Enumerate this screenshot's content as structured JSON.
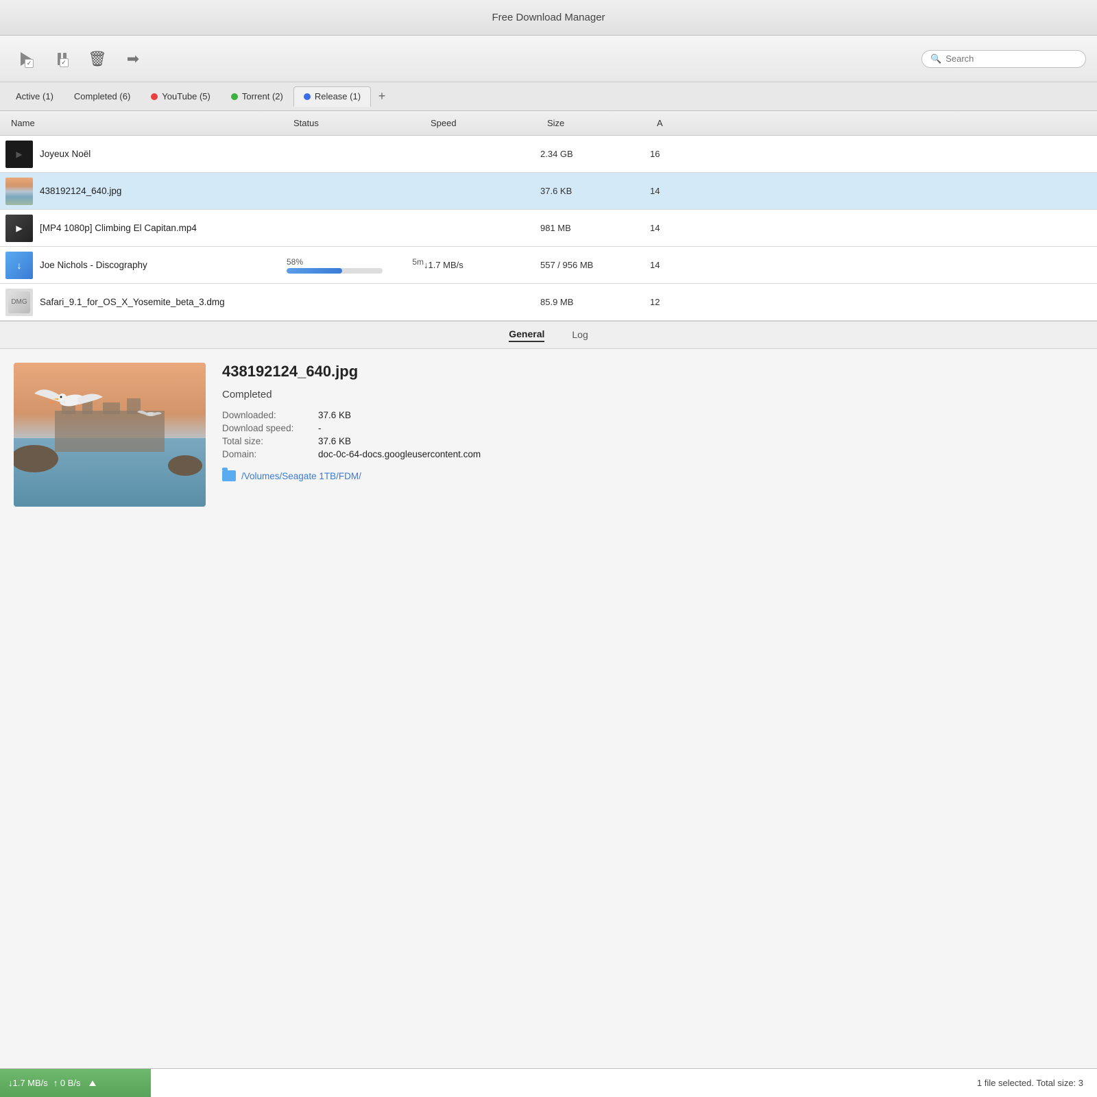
{
  "window": {
    "title": "Free Download Manager"
  },
  "toolbar": {
    "play_label": "▶",
    "pause_label": "⏸",
    "delete_label": "🗑",
    "move_label": "➡",
    "search_placeholder": "Search"
  },
  "tabs": [
    {
      "id": "active",
      "label": "Active (1)",
      "dot_color": null,
      "active": false
    },
    {
      "id": "completed",
      "label": "Completed (6)",
      "dot_color": null,
      "active": false
    },
    {
      "id": "youtube",
      "label": "YouTube (5)",
      "dot_color": "#e84040",
      "active": false
    },
    {
      "id": "torrent",
      "label": "Torrent (2)",
      "dot_color": "#3db03d",
      "active": false
    },
    {
      "id": "release",
      "label": "Release (1)",
      "dot_color": "#3a6be8",
      "active": false
    }
  ],
  "table": {
    "headers": {
      "name": "Name",
      "status": "Status",
      "speed": "Speed",
      "size": "Size",
      "added": "A"
    }
  },
  "downloads": [
    {
      "id": "joyeux",
      "name": "Joyeux Noël",
      "status": "",
      "speed": "",
      "size": "2.34 GB",
      "added": "16",
      "thumb_type": "film",
      "selected": false
    },
    {
      "id": "jpg",
      "name": "438192124_640.jpg",
      "status": "",
      "speed": "",
      "size": "37.6 KB",
      "added": "14",
      "thumb_type": "image",
      "selected": true
    },
    {
      "id": "mp4",
      "name": "[MP4 1080p] Climbing El Capitan.mp4",
      "status": "",
      "speed": "",
      "size": "981 MB",
      "added": "14",
      "thumb_type": "video",
      "selected": false
    },
    {
      "id": "torrent",
      "name": "Joe Nichols - Discography",
      "status_percent": "58%",
      "status_time": "5m",
      "speed": "↓1.7 MB/s",
      "size": "557 / 956 MB",
      "added": "14",
      "progress": 58,
      "thumb_type": "torrent",
      "selected": false
    },
    {
      "id": "dmg",
      "name": "Safari_9.1_for_OS_X_Yosemite_beta_3.dmg",
      "status": "",
      "speed": "",
      "size": "85.9 MB",
      "added": "12",
      "thumb_type": "dmg",
      "selected": false
    }
  ],
  "detail": {
    "tabs": [
      "General",
      "Log"
    ],
    "active_tab": "General",
    "filename": "438192124_640.jpg",
    "status": "Completed",
    "downloaded_label": "Downloaded:",
    "downloaded_value": "37.6 KB",
    "speed_label": "Download speed:",
    "speed_value": "-",
    "size_label": "Total size:",
    "size_value": "37.6 KB",
    "domain_label": "Domain:",
    "domain_value": "doc-0c-64-docs.googleusercontent.com",
    "folder_path": "/Volumes/Seagate 1TB/FDM/"
  },
  "statusbar": {
    "download_speed": "↓1.7 MB/s",
    "upload_speed": "↑ 0 B/s",
    "selection_info": "1 file selected. Total size: 3"
  }
}
